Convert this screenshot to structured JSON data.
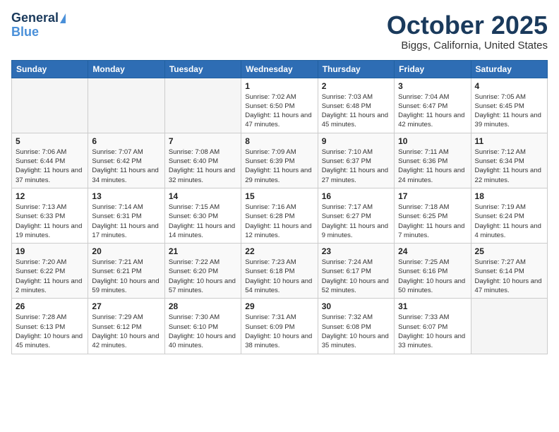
{
  "header": {
    "logo": {
      "line1": "General",
      "line2": "Blue"
    },
    "title": "October 2025",
    "location": "Biggs, California, United States"
  },
  "weekdays": [
    "Sunday",
    "Monday",
    "Tuesday",
    "Wednesday",
    "Thursday",
    "Friday",
    "Saturday"
  ],
  "weeks": [
    [
      {
        "day": "",
        "info": ""
      },
      {
        "day": "",
        "info": ""
      },
      {
        "day": "",
        "info": ""
      },
      {
        "day": "1",
        "info": "Sunrise: 7:02 AM\nSunset: 6:50 PM\nDaylight: 11 hours\nand 47 minutes."
      },
      {
        "day": "2",
        "info": "Sunrise: 7:03 AM\nSunset: 6:48 PM\nDaylight: 11 hours\nand 45 minutes."
      },
      {
        "day": "3",
        "info": "Sunrise: 7:04 AM\nSunset: 6:47 PM\nDaylight: 11 hours\nand 42 minutes."
      },
      {
        "day": "4",
        "info": "Sunrise: 7:05 AM\nSunset: 6:45 PM\nDaylight: 11 hours\nand 39 minutes."
      }
    ],
    [
      {
        "day": "5",
        "info": "Sunrise: 7:06 AM\nSunset: 6:44 PM\nDaylight: 11 hours\nand 37 minutes."
      },
      {
        "day": "6",
        "info": "Sunrise: 7:07 AM\nSunset: 6:42 PM\nDaylight: 11 hours\nand 34 minutes."
      },
      {
        "day": "7",
        "info": "Sunrise: 7:08 AM\nSunset: 6:40 PM\nDaylight: 11 hours\nand 32 minutes."
      },
      {
        "day": "8",
        "info": "Sunrise: 7:09 AM\nSunset: 6:39 PM\nDaylight: 11 hours\nand 29 minutes."
      },
      {
        "day": "9",
        "info": "Sunrise: 7:10 AM\nSunset: 6:37 PM\nDaylight: 11 hours\nand 27 minutes."
      },
      {
        "day": "10",
        "info": "Sunrise: 7:11 AM\nSunset: 6:36 PM\nDaylight: 11 hours\nand 24 minutes."
      },
      {
        "day": "11",
        "info": "Sunrise: 7:12 AM\nSunset: 6:34 PM\nDaylight: 11 hours\nand 22 minutes."
      }
    ],
    [
      {
        "day": "12",
        "info": "Sunrise: 7:13 AM\nSunset: 6:33 PM\nDaylight: 11 hours\nand 19 minutes."
      },
      {
        "day": "13",
        "info": "Sunrise: 7:14 AM\nSunset: 6:31 PM\nDaylight: 11 hours\nand 17 minutes."
      },
      {
        "day": "14",
        "info": "Sunrise: 7:15 AM\nSunset: 6:30 PM\nDaylight: 11 hours\nand 14 minutes."
      },
      {
        "day": "15",
        "info": "Sunrise: 7:16 AM\nSunset: 6:28 PM\nDaylight: 11 hours\nand 12 minutes."
      },
      {
        "day": "16",
        "info": "Sunrise: 7:17 AM\nSunset: 6:27 PM\nDaylight: 11 hours\nand 9 minutes."
      },
      {
        "day": "17",
        "info": "Sunrise: 7:18 AM\nSunset: 6:25 PM\nDaylight: 11 hours\nand 7 minutes."
      },
      {
        "day": "18",
        "info": "Sunrise: 7:19 AM\nSunset: 6:24 PM\nDaylight: 11 hours\nand 4 minutes."
      }
    ],
    [
      {
        "day": "19",
        "info": "Sunrise: 7:20 AM\nSunset: 6:22 PM\nDaylight: 11 hours\nand 2 minutes."
      },
      {
        "day": "20",
        "info": "Sunrise: 7:21 AM\nSunset: 6:21 PM\nDaylight: 10 hours\nand 59 minutes."
      },
      {
        "day": "21",
        "info": "Sunrise: 7:22 AM\nSunset: 6:20 PM\nDaylight: 10 hours\nand 57 minutes."
      },
      {
        "day": "22",
        "info": "Sunrise: 7:23 AM\nSunset: 6:18 PM\nDaylight: 10 hours\nand 54 minutes."
      },
      {
        "day": "23",
        "info": "Sunrise: 7:24 AM\nSunset: 6:17 PM\nDaylight: 10 hours\nand 52 minutes."
      },
      {
        "day": "24",
        "info": "Sunrise: 7:25 AM\nSunset: 6:16 PM\nDaylight: 10 hours\nand 50 minutes."
      },
      {
        "day": "25",
        "info": "Sunrise: 7:27 AM\nSunset: 6:14 PM\nDaylight: 10 hours\nand 47 minutes."
      }
    ],
    [
      {
        "day": "26",
        "info": "Sunrise: 7:28 AM\nSunset: 6:13 PM\nDaylight: 10 hours\nand 45 minutes."
      },
      {
        "day": "27",
        "info": "Sunrise: 7:29 AM\nSunset: 6:12 PM\nDaylight: 10 hours\nand 42 minutes."
      },
      {
        "day": "28",
        "info": "Sunrise: 7:30 AM\nSunset: 6:10 PM\nDaylight: 10 hours\nand 40 minutes."
      },
      {
        "day": "29",
        "info": "Sunrise: 7:31 AM\nSunset: 6:09 PM\nDaylight: 10 hours\nand 38 minutes."
      },
      {
        "day": "30",
        "info": "Sunrise: 7:32 AM\nSunset: 6:08 PM\nDaylight: 10 hours\nand 35 minutes."
      },
      {
        "day": "31",
        "info": "Sunrise: 7:33 AM\nSunset: 6:07 PM\nDaylight: 10 hours\nand 33 minutes."
      },
      {
        "day": "",
        "info": ""
      }
    ]
  ]
}
